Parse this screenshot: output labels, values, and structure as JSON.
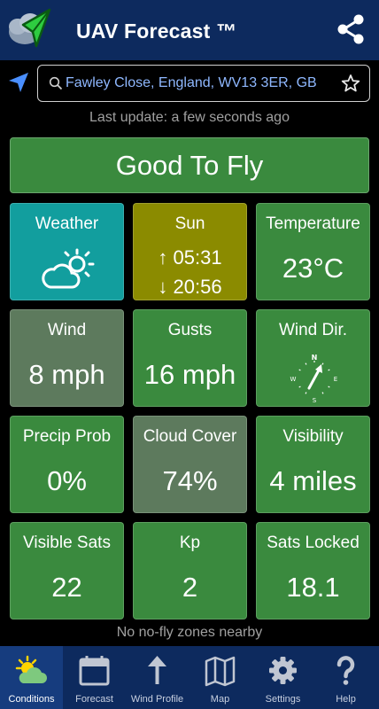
{
  "app": {
    "title": "UAV Forecast ™"
  },
  "location": {
    "value": "Fawley Close, England, WV13 3ER, GB"
  },
  "status": {
    "last_update": "Last update: a few seconds ago",
    "fly_verdict": "Good To Fly",
    "no_fly": "No no-fly zones nearby"
  },
  "tiles": {
    "weather": {
      "label": "Weather",
      "icon": "partly-cloudy-icon",
      "color": "#129e9e"
    },
    "sun": {
      "label": "Sun",
      "sunrise": "↑ 05:31",
      "sunset": "↓ 20:56",
      "color": "#8b8b00"
    },
    "temperature": {
      "label": "Temperature",
      "value": "23°C"
    },
    "wind": {
      "label": "Wind",
      "value": "8 mph"
    },
    "gusts": {
      "label": "Gusts",
      "value": "16 mph"
    },
    "wind_dir": {
      "label": "Wind Dir.",
      "icon": "compass-icon",
      "compass": [
        "N",
        "E",
        "S",
        "W"
      ]
    },
    "precip": {
      "label": "Precip Prob",
      "value": "0%"
    },
    "cloud": {
      "label": "Cloud Cover",
      "value": "74%"
    },
    "visibility": {
      "label": "Visibility",
      "value": "4 miles"
    },
    "sats_visible": {
      "label": "Visible Sats",
      "value": "22"
    },
    "kp": {
      "label": "Kp",
      "value": "2"
    },
    "sats_locked": {
      "label": "Sats Locked",
      "value": "18.1"
    }
  },
  "colors": {
    "good": "#3a8a3e",
    "caution": "#5d7a5d",
    "header": "#0d2a5e"
  },
  "nav": [
    {
      "label": "Conditions",
      "icon": "sun-cloud-icon",
      "active": true
    },
    {
      "label": "Forecast",
      "icon": "calendar-icon"
    },
    {
      "label": "Wind Profile",
      "icon": "arrow-up-icon"
    },
    {
      "label": "Map",
      "icon": "map-icon"
    },
    {
      "label": "Settings",
      "icon": "gear-icon"
    },
    {
      "label": "Help",
      "icon": "question-icon"
    }
  ]
}
